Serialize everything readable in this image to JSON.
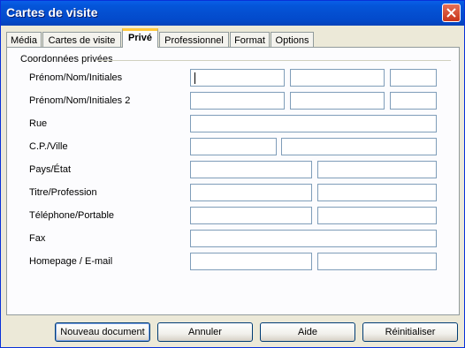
{
  "window": {
    "title": "Cartes de visite"
  },
  "tabs": [
    {
      "label": "Média"
    },
    {
      "label": "Cartes de visite"
    },
    {
      "label": "Privé"
    },
    {
      "label": "Professionnel"
    },
    {
      "label": "Format"
    },
    {
      "label": "Options"
    }
  ],
  "active_tab": "Privé",
  "group": {
    "label": "Coordonnées privées"
  },
  "rows": [
    {
      "label": "Prénom/Nom/Initiales"
    },
    {
      "label": "Prénom/Nom/Initiales 2"
    },
    {
      "label": "Rue"
    },
    {
      "label": "C.P./Ville"
    },
    {
      "label": "Pays/État"
    },
    {
      "label": "Titre/Profession"
    },
    {
      "label": "Téléphone/Portable"
    },
    {
      "label": "Fax"
    },
    {
      "label": "Homepage / E-mail"
    }
  ],
  "buttons": {
    "new_document": "Nouveau document",
    "cancel": "Annuler",
    "help": "Aide",
    "reset": "Réinitialiser"
  },
  "icons": {
    "close": "close-icon"
  },
  "colors": {
    "titlebar": "#0455d9",
    "active_tab_accent": "#ffc83c",
    "field_border": "#7f9db9"
  }
}
